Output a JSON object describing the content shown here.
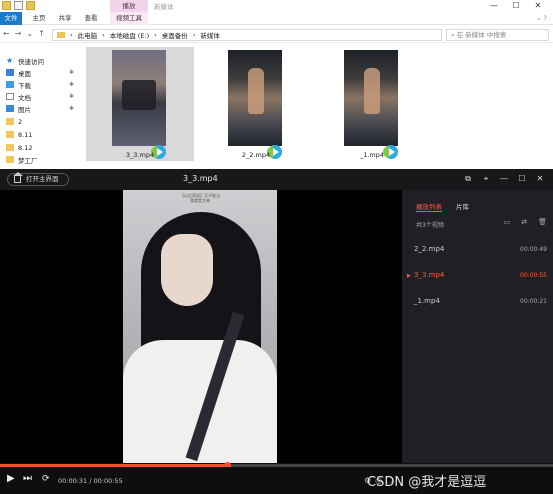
{
  "explorer": {
    "title_context_tab": "播放",
    "window_title": "新媒体",
    "window_controls": [
      "—",
      "☐",
      "✕"
    ],
    "ribbon_tabs": [
      "文件",
      "主页",
      "共享",
      "查看",
      "视频工具"
    ],
    "ribbon_help": "⌄ ?",
    "nav_buttons": [
      "←",
      "→",
      "⌄",
      "↑"
    ],
    "breadcrumb": [
      "此电脑",
      "本地磁盘 (E:)",
      "桌面备份",
      "新媒体"
    ],
    "search_placeholder": "在 新媒体 中搜索",
    "sidebar": [
      {
        "label": "快速访问",
        "icon": "star-icon",
        "pinned": false
      },
      {
        "label": "桌面",
        "icon": "desktop-icon",
        "pinned": true
      },
      {
        "label": "下载",
        "icon": "download-icon",
        "pinned": true
      },
      {
        "label": "文档",
        "icon": "document-icon",
        "pinned": true
      },
      {
        "label": "图片",
        "icon": "picture-icon",
        "pinned": true
      },
      {
        "label": "2",
        "icon": "folder-icon",
        "pinned": false
      },
      {
        "label": "8.11",
        "icon": "folder-icon",
        "pinned": false
      },
      {
        "label": "8.12",
        "icon": "folder-icon",
        "pinned": false
      },
      {
        "label": "梦工厂",
        "icon": "folder-icon",
        "pinned": false
      }
    ],
    "files": [
      {
        "name": "3_3.mp4",
        "selected": true
      },
      {
        "name": "2_2.mp4",
        "selected": false
      },
      {
        "name": "_1.mp4",
        "selected": false
      }
    ]
  },
  "player": {
    "home_button": "打开主界面",
    "title": "3_3.mp4",
    "controls": [
      "⧉",
      "⌖",
      "—",
      "☐",
      "✕"
    ],
    "video_caption_line1": "【以后再说】又不能当",
    "video_caption_line2": "我就是大神",
    "playlist_tabs": [
      "播放列表",
      "片库"
    ],
    "playlist_count": "共3个视频",
    "playlist_tools": [
      "▭",
      "⇄",
      "🗑"
    ],
    "playlist": [
      {
        "name": "2_2.mp4",
        "duration": "00:00:49",
        "active": false
      },
      {
        "name": "3_3.mp4",
        "duration": "00:00:55",
        "active": true
      },
      {
        "name": "_1.mp4",
        "duration": "00:00:21",
        "active": false
      }
    ],
    "progress": 0.41,
    "time_display": "00:00:31 / 00:00:55",
    "bottom_left_buttons": [
      "▶",
      "⏭",
      "⟳"
    ],
    "watermark": "CSDN @我才是逗逗"
  }
}
